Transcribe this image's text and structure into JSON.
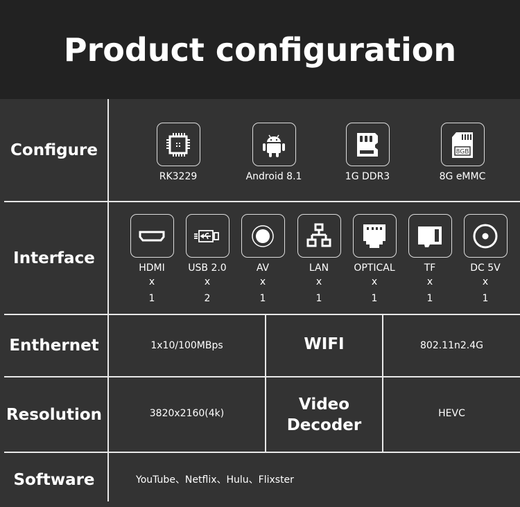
{
  "title": "Product configuration",
  "rows": {
    "configure": {
      "label": "Configure",
      "items": [
        {
          "icon": "cpu-chip-icon",
          "label": "RK3229"
        },
        {
          "icon": "android-icon",
          "label": "Android 8.1"
        },
        {
          "icon": "sd-card-icon",
          "label": "1G DDR3"
        },
        {
          "icon": "emmc-card-icon",
          "label": "8G eMMC",
          "badge": "8GB"
        }
      ]
    },
    "interface": {
      "label": "Interface",
      "items": [
        {
          "icon": "hdmi-port-icon",
          "label": "HDMI",
          "x": "x",
          "count": "1"
        },
        {
          "icon": "usb-icon",
          "label": "USB 2.0",
          "x": "x",
          "count": "2"
        },
        {
          "icon": "av-port-icon",
          "label": "AV",
          "x": "x",
          "count": "1"
        },
        {
          "icon": "lan-network-icon",
          "label": "LAN",
          "x": "x",
          "count": "1"
        },
        {
          "icon": "optical-port-icon",
          "label": "OPTICAL",
          "x": "x",
          "count": "1"
        },
        {
          "icon": "tf-card-icon",
          "label": "TF",
          "x": "x",
          "count": "1"
        },
        {
          "icon": "dc-power-icon",
          "label": "DC 5V",
          "x": "x",
          "count": "1"
        }
      ]
    },
    "ethernet": {
      "label": "Enthernet",
      "value": "1x10/100MBps",
      "sub_label": "WIFI",
      "sub_value": "802.11n2.4G"
    },
    "resolution": {
      "label": "Resolution",
      "value": "3820x2160(4k)",
      "sub_label_line1": "Video",
      "sub_label_line2": "Decoder",
      "sub_value": "HEVC"
    },
    "software": {
      "label": "Software",
      "value": "YouTube、Netflix、Hulu、Flixster"
    }
  }
}
